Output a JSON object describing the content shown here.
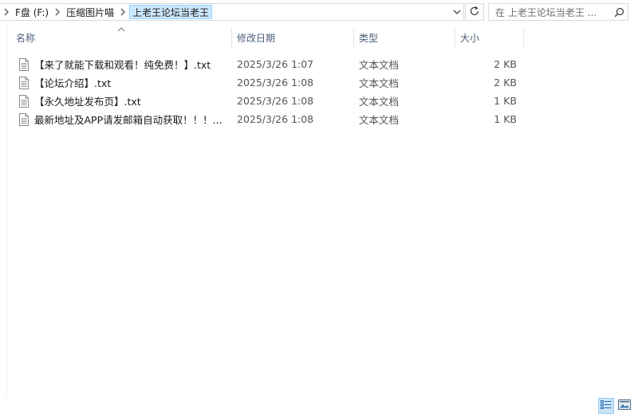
{
  "address_bar": {
    "breadcrumbs": [
      "F盘 (F:)",
      "压缩图片喵",
      "上老王论坛当老王"
    ]
  },
  "search": {
    "placeholder": "在 上老王论坛当老王 ..."
  },
  "columns": {
    "name": "名称",
    "modified": "修改日期",
    "type": "类型",
    "size": "大小"
  },
  "files": [
    {
      "name": "【来了就能下载和观看！纯免费！】.txt",
      "modified": "2025/3/26 1:07",
      "type": "文本文档",
      "size": "2 KB"
    },
    {
      "name": "【论坛介绍】.txt",
      "modified": "2025/3/26 1:08",
      "type": "文本文档",
      "size": "2 KB"
    },
    {
      "name": "【永久地址发布页】.txt",
      "modified": "2025/3/26 1:08",
      "type": "文本文档",
      "size": "1 KB"
    },
    {
      "name": "最新地址及APP请发邮箱自动获取！！！...",
      "modified": "2025/3/26 1:08",
      "type": "文本文档",
      "size": "1 KB"
    }
  ],
  "icons": {
    "file": "text-file-icon",
    "search": "search-icon",
    "refresh": "refresh-icon",
    "dropdown": "chevron-down-icon",
    "sort": "sort-ascending-icon"
  },
  "colors": {
    "selected_crumb": "#cce8ff",
    "header_text": "#4c607a",
    "active_view": "#cce4f7"
  }
}
